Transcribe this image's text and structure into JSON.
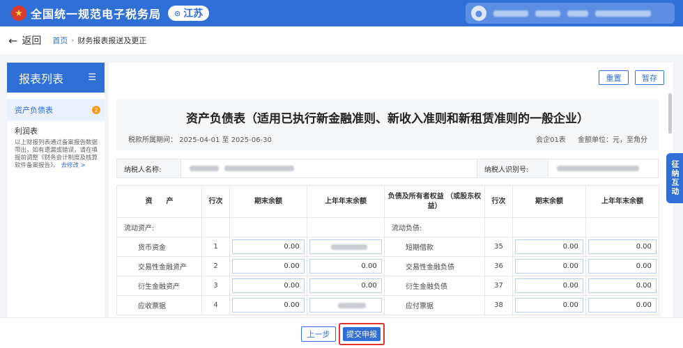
{
  "header": {
    "site_title": "全国统一规范电子税务局",
    "region": "江苏",
    "logo_icon": "national-emblem-icon",
    "brand_color": "#2f6fd6"
  },
  "breadcrumb": {
    "back_label": "返回",
    "home": "首页",
    "separator": "›",
    "current": "财务报表报送及更正"
  },
  "sidebar": {
    "title": "报表列表",
    "items": [
      {
        "label": "资产负债表",
        "badge": "2"
      },
      {
        "label": "利润表"
      }
    ],
    "note": "以上财报列表通过备案报告数据带出，如有遗漏或错误，请在填报前调整《财务会计制度及核算软件备案报告》。",
    "note_link": "去修改 >"
  },
  "toolbar": {
    "reset_label": "重置",
    "save_label": "暂存"
  },
  "report": {
    "title": "资产负债表（适用已执行新金融准则、新收入准则和新租赁准则的一般企业）",
    "period_label": "税款所属期间：",
    "period_start": "2025-04-01",
    "period_to": "至",
    "period_end": "2025-06-30",
    "form_code": "会企01表",
    "unit": "金额单位：元，至角分"
  },
  "taxpayer": {
    "name_label": "纳税人名称:",
    "id_label": "纳税人识别号:"
  },
  "table": {
    "headers": [
      "资　　产",
      "行次",
      "期末余额",
      "上年年末余额",
      "负债及所有者权益 （或股东权益）",
      "行次",
      "期末余额",
      "上年年末余额"
    ],
    "section_left": "流动资产:",
    "section_right": "流动负债:",
    "rows": [
      {
        "asset": "货币资金",
        "no": "1",
        "end": "0.00",
        "prev": "",
        "liab": "短期借款",
        "lno": "35",
        "lend": "0.00",
        "lprev": "0.00"
      },
      {
        "asset": "交易性金融资产",
        "no": "2",
        "end": "0.00",
        "prev": "0.00",
        "liab": "交易性金融负债",
        "lno": "36",
        "lend": "0.00",
        "lprev": "0.00"
      },
      {
        "asset": "衍生金融资产",
        "no": "3",
        "end": "0.00",
        "prev": "0.00",
        "liab": "衍生金融负债",
        "lno": "37",
        "lend": "0.00",
        "lprev": "0.00"
      },
      {
        "asset": "应收票据",
        "no": "4",
        "end": "0.00",
        "prev": "",
        "liab": "应付票据",
        "lno": "38",
        "lend": "0.00",
        "lprev": "0.00"
      }
    ]
  },
  "side_tab": "征纳互动",
  "footer": {
    "prev_label": "上一步",
    "submit_label": "提交申报"
  }
}
